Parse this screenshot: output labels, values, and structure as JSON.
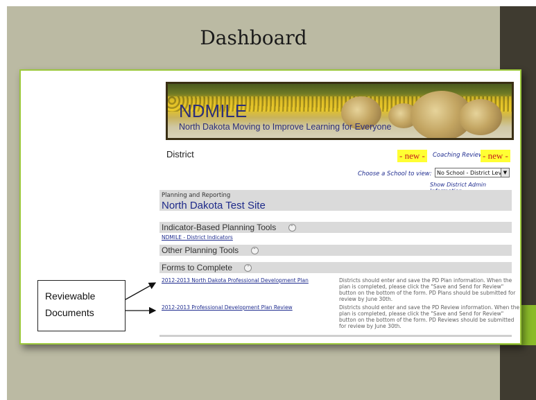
{
  "slide": {
    "title": "Dashboard",
    "colors": {
      "background": "#bbbaa3",
      "right_bar": "#3f3b30",
      "accent": "#8bbb2a",
      "box_border": "#9cc83c"
    }
  },
  "banner": {
    "title": "NDMILE",
    "subtitle": "North Dakota Moving to Improve Learning for Everyone"
  },
  "header": {
    "district_label": "District",
    "new_badge_1": "- new -",
    "coaching_review": "Coaching Review",
    "new_badge_2": "- new -",
    "choose_school_label": "Choose a School to view:",
    "school_select_value": "No School - District Level",
    "admin_link": "Show District Admin Information"
  },
  "planning": {
    "label": "Planning and Reporting",
    "site_name": "North Dakota Test Site"
  },
  "sections": {
    "indicator_tools": {
      "title": "Indicator-Based Planning Tools",
      "link": "NDMILE - District Indicators"
    },
    "other_tools": {
      "title": "Other Planning Tools"
    },
    "forms": {
      "title": "Forms to Complete",
      "items": [
        {
          "link": "2012-2013 North Dakota Professional Development Plan",
          "description": "Districts should enter and save the PD Plan information. When the plan is completed, please click the \"Save and Send for Review\" button on the bottom of the form. PD Plans should be submitted for review by June 30th."
        },
        {
          "link": "2012-2013 Professional Development Plan Review",
          "description": "Districts should enter and save the PD Review information. When the plan is completed, please click the \"Save and Send for Review\" button on the bottom of the form. PD Reviews should be submitted for review by June 30th."
        }
      ]
    }
  },
  "callout": {
    "line1": "Reviewable",
    "line2": "Documents"
  }
}
